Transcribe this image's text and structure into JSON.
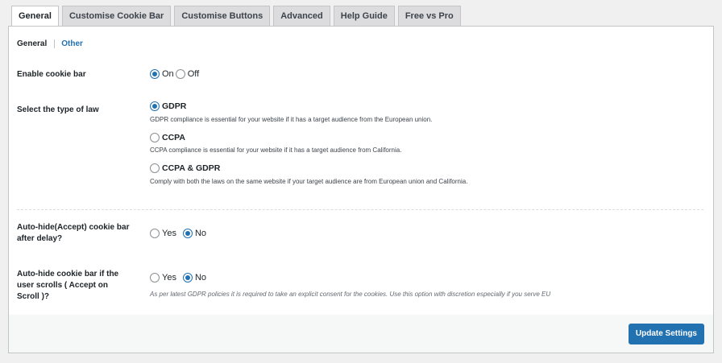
{
  "tabs": [
    "General",
    "Customise Cookie Bar",
    "Customise Buttons",
    "Advanced",
    "Help Guide",
    "Free vs Pro"
  ],
  "subtabs": {
    "general": "General",
    "other": "Other"
  },
  "enable_cookie_bar": {
    "label": "Enable cookie bar",
    "on": "On",
    "off": "Off",
    "selected": "On"
  },
  "law_type": {
    "label": "Select the type of law",
    "selected": "GDPR",
    "options": [
      {
        "name": "GDPR",
        "desc": "GDPR compliance is essential for your website if it has a target audience from the European union."
      },
      {
        "name": "CCPA",
        "desc": "CCPA compliance is essential for your website if it has a target audience from California."
      },
      {
        "name": "CCPA & GDPR",
        "desc": "Comply with both the laws on the same website if your target audience are from European union and California."
      }
    ]
  },
  "auto_hide_delay": {
    "label_line1": "Auto-hide(Accept) cookie bar",
    "label_line2": "after delay?",
    "yes": "Yes",
    "no": "No",
    "selected": "No"
  },
  "auto_hide_scroll": {
    "label_line1": "Auto-hide cookie bar if the",
    "label_line2": "user scrolls ( Accept on",
    "label_line3": "Scroll )?",
    "yes": "Yes",
    "no": "No",
    "selected": "No",
    "note": "As per latest GDPR policies it is required to take an explicit consent for the cookies. Use this option with discretion especially if you serve EU"
  },
  "update_button": "Update Settings",
  "colors": {
    "accent": "#2271b1",
    "tab_bg": "#dcdcde",
    "page_bg": "#f0f0f1"
  }
}
